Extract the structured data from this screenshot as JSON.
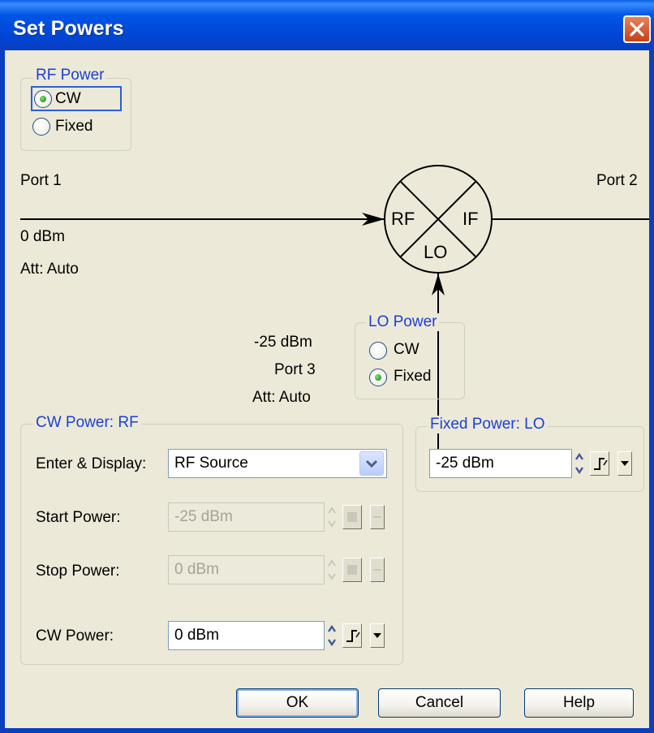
{
  "window": {
    "title": "Set Powers"
  },
  "rf_power": {
    "legend": "RF Power",
    "options": [
      "CW",
      "Fixed"
    ],
    "selected": "CW"
  },
  "diagram": {
    "port1": "Port 1",
    "port2": "Port 2",
    "port1_power": "0 dBm",
    "port1_att": "Att: Auto",
    "mixer_labels": {
      "rf": "RF",
      "if": "IF",
      "lo": "LO"
    },
    "port3_power": "-25 dBm",
    "port3": "Port 3",
    "port3_att": "Att: Auto"
  },
  "lo_power": {
    "legend": "LO Power",
    "options": [
      "CW",
      "Fixed"
    ],
    "selected": "Fixed"
  },
  "cw_power_rf": {
    "legend": "CW Power: RF",
    "enter_display_label": "Enter & Display:",
    "enter_display_value": "RF Source",
    "start_power_label": "Start Power:",
    "start_power_value": "-25 dBm",
    "stop_power_label": "Stop Power:",
    "stop_power_value": "0 dBm",
    "cw_power_label": "CW Power:",
    "cw_power_value": "0 dBm"
  },
  "fixed_power_lo": {
    "legend": "Fixed Power: LO",
    "value": "-25 dBm"
  },
  "buttons": {
    "ok": "OK",
    "cancel": "Cancel",
    "help": "Help"
  },
  "colors": {
    "titlebar": "#0054e3",
    "dialog_bg": "#ece9d8",
    "group_label": "#1c3fd6",
    "radio_selected": "#2fa02a"
  }
}
